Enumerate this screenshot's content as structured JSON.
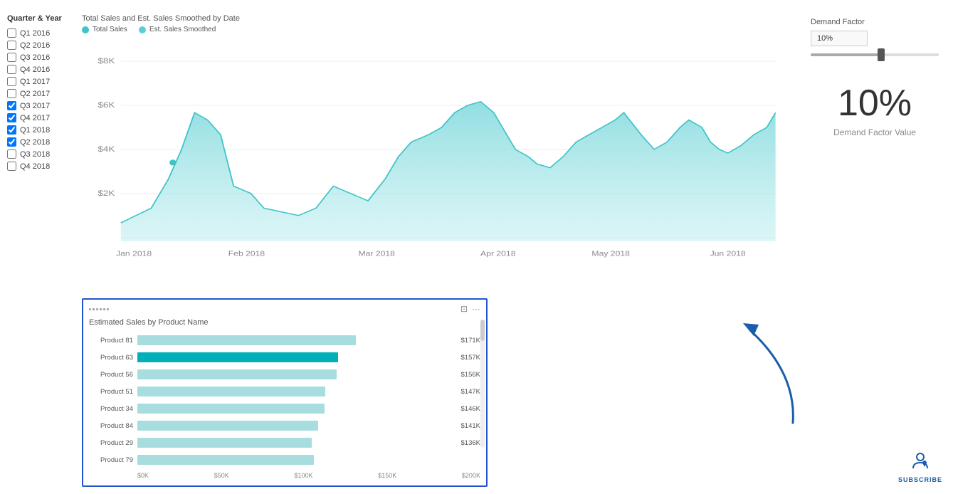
{
  "sidebar": {
    "title": "Quarter & Year",
    "filters": [
      {
        "label": "Q1 2016",
        "checked": false
      },
      {
        "label": "Q2 2016",
        "checked": false
      },
      {
        "label": "Q3 2016",
        "checked": false
      },
      {
        "label": "Q4 2016",
        "checked": false
      },
      {
        "label": "Q1 2017",
        "checked": false
      },
      {
        "label": "Q2 2017",
        "checked": false
      },
      {
        "label": "Q3 2017",
        "checked": true
      },
      {
        "label": "Q4 2017",
        "checked": true
      },
      {
        "label": "Q1 2018",
        "checked": true
      },
      {
        "label": "Q2 2018",
        "checked": true
      },
      {
        "label": "Q3 2018",
        "checked": false
      },
      {
        "label": "Q4 2018",
        "checked": false
      }
    ]
  },
  "area_chart": {
    "title": "Total Sales and Est. Sales Smoothed by Date",
    "legend": [
      {
        "label": "Total Sales",
        "color": "#3fc4c8"
      },
      {
        "label": "Est. Sales Smoothed",
        "color": "#5ad0d4"
      }
    ],
    "y_labels": [
      "$8K",
      "$6K",
      "$4K",
      "$2K"
    ],
    "x_labels": [
      "Jan 2018",
      "Feb 2018",
      "Mar 2018",
      "Apr 2018",
      "May 2018",
      "Jun 2018"
    ]
  },
  "bar_chart": {
    "title": "Estimated Sales by Product Name",
    "rows": [
      {
        "label": "Product 81",
        "value": "$171K",
        "pct": 85.5,
        "dark": false
      },
      {
        "label": "Product 63",
        "value": "$157K",
        "pct": 78.5,
        "dark": true
      },
      {
        "label": "Product 56",
        "value": "$156K",
        "pct": 78.0,
        "dark": false
      },
      {
        "label": "Product 51",
        "value": "$147K",
        "pct": 73.5,
        "dark": false
      },
      {
        "label": "Product 34",
        "value": "$146K",
        "pct": 73.0,
        "dark": false
      },
      {
        "label": "Product 84",
        "value": "$141K",
        "pct": 70.5,
        "dark": false
      },
      {
        "label": "Product 29",
        "value": "$136K",
        "pct": 68.0,
        "dark": false
      },
      {
        "label": "Product 79",
        "value": "",
        "pct": 65.0,
        "dark": false
      }
    ],
    "x_axis_labels": [
      "$0K",
      "$50K",
      "$100K",
      "$150K",
      "$200K"
    ]
  },
  "demand_factor": {
    "label": "Demand Factor",
    "box_value": "10%",
    "slider_pct": 55,
    "big_value": "10%",
    "value_label": "Demand Factor Value"
  },
  "subscribe": {
    "label": "SUBSCRIBE"
  }
}
